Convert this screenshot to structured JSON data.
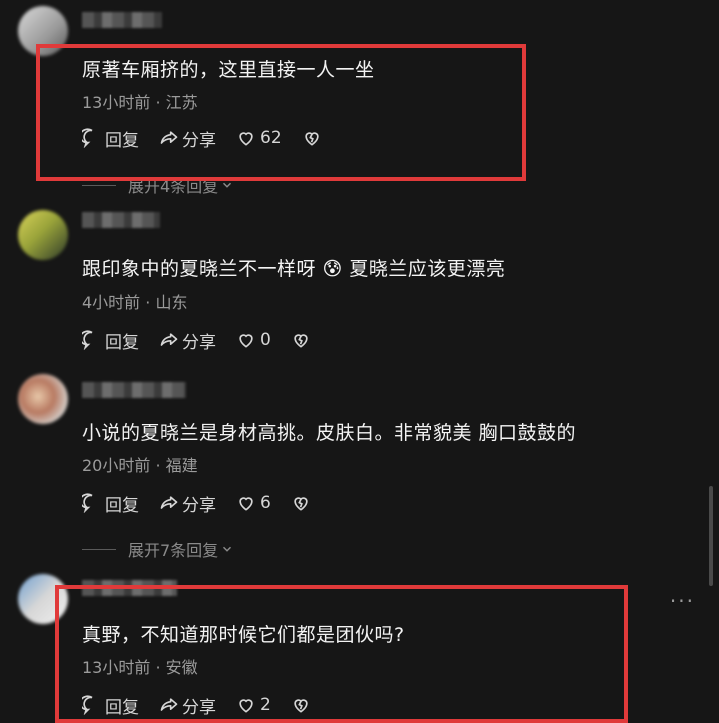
{
  "comments": [
    {
      "text": "原著车厢挤的，这里直接一人一坐",
      "meta": "13小时前 · 江苏",
      "reply_label": "回复",
      "share_label": "分享",
      "likes": "62",
      "expand_label": "展开4条回复"
    },
    {
      "text": "跟印象中的夏晓兰不一样呀 😰 夏晓兰应该更漂亮",
      "meta": "4小时前 · 山东",
      "reply_label": "回复",
      "share_label": "分享",
      "likes": "0"
    },
    {
      "text": "小说的夏晓兰是身材高挑。皮肤白。非常貌美 胸口鼓鼓的",
      "meta": "20小时前 · 福建",
      "reply_label": "回复",
      "share_label": "分享",
      "likes": "6",
      "expand_label": "展开7条回复"
    },
    {
      "text": "真野，不知道那时候它们都是团伙吗?",
      "meta": "13小时前 · 安徽",
      "reply_label": "回复",
      "share_label": "分享",
      "likes": "2"
    }
  ],
  "icons": {
    "reply": "comment-bubble-icon",
    "share": "share-arrow-icon",
    "like": "heart-icon",
    "dislike": "broken-heart-icon",
    "expand": "chevron-down-icon",
    "more": "more-dots-icon"
  },
  "colors": {
    "background": "#161616",
    "highlight": "#e03a3a",
    "meta_text": "#9b9b9b"
  }
}
